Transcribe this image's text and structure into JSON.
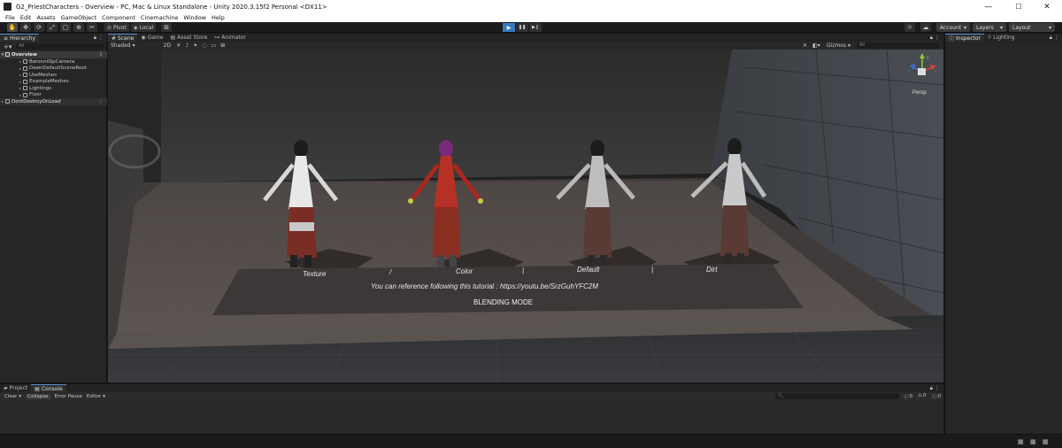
{
  "window": {
    "title": "G2_PriestCharacters - Overview - PC, Mac & Linux Standalone - Unity 2020.3.15f2 Personal <DX11>",
    "minimize": "—",
    "maximize": "☐",
    "close": "✕"
  },
  "menu": [
    "File",
    "Edit",
    "Assets",
    "GameObject",
    "Component",
    "Cinemachine",
    "Window",
    "Help"
  ],
  "toolbar": {
    "pivot_label": "Pivot",
    "local_label": "Local",
    "account_label": "Account",
    "layers_label": "Layers",
    "layout_label": "Layout",
    "play_icon": "▶",
    "pause_icon": "❚❚",
    "step_icon": "▶❙"
  },
  "hierarchy": {
    "tab_label": "Hierarchy",
    "search_placeholder": "All",
    "scene_name": "Overview",
    "items": [
      "BaronnilSpCamera",
      "DawnDefaultSceneRoot",
      "UseMeshes",
      "ExampleMeshes",
      "Lightings",
      "Floor"
    ],
    "dont_destroy": "DontDestroyOnLoad"
  },
  "scene_tabs": {
    "scene": "Scene",
    "game": "Game",
    "asset_store": "Asset Store",
    "animator": "Animator"
  },
  "scene_toolbar": {
    "shading_mode": "Shaded",
    "mode_2d": "2D",
    "gizmos": "Gizmos",
    "search_placeholder": "All"
  },
  "scene_canvas": {
    "labels": [
      "Texture",
      "/",
      "Color",
      "|",
      "Default",
      "|",
      "Dirt"
    ],
    "tutorial_text": "You can reference following this tutorial : https://youtu.be/SrzGuhYFC2M",
    "blending_mode": "BLENDING MODE",
    "persp_label": "Persp",
    "axis_y": "y",
    "axis_x": "x",
    "axis_z": "z"
  },
  "inspector": {
    "tab_inspector": "Inspector",
    "tab_lighting": "Lighting"
  },
  "console": {
    "tab_project": "Project",
    "tab_console": "Console",
    "clear": "Clear",
    "collapse": "Collapse",
    "error_pause": "Error Pause",
    "editor": "Editor",
    "log_count": "0",
    "warn_count": "0",
    "error_count": "0"
  },
  "colors": {
    "accent": "#3a79bb",
    "panel": "#262626",
    "sky": "#2a2a2a"
  }
}
